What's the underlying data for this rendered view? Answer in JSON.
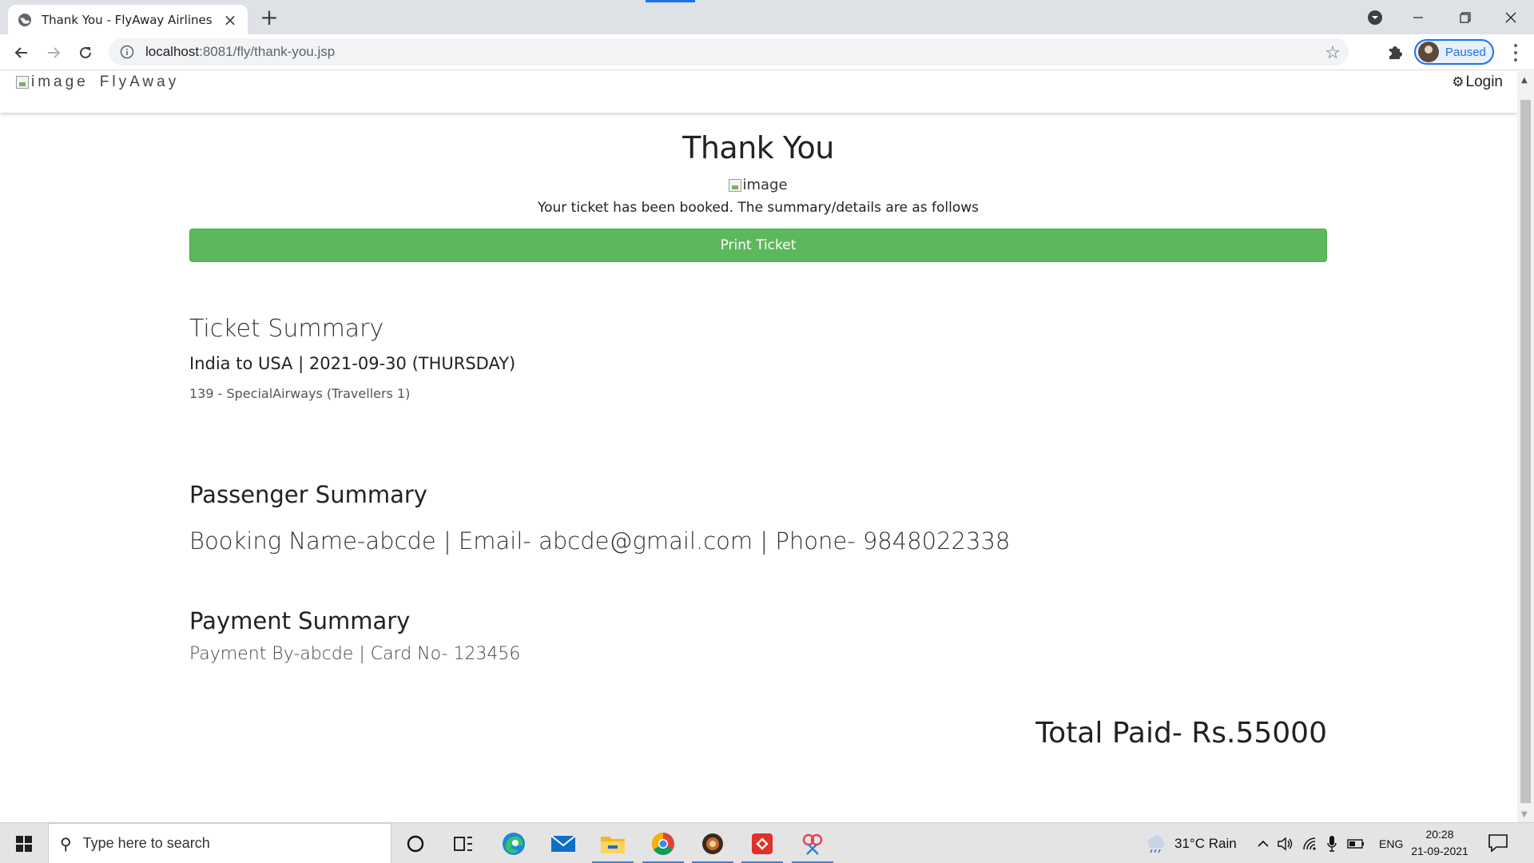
{
  "browser": {
    "tab_title": "Thank You - FlyAway Airlines",
    "url_host": "localhost",
    "url_path": ":8081/fly/thank-you.jsp",
    "profile_status": "Paused"
  },
  "site": {
    "brand_alt": "image",
    "brand_name": "FlyAway",
    "login_label": "Login"
  },
  "main": {
    "title": "Thank You",
    "hero_alt": "image",
    "booked_message": "Your ticket has been booked. The summary/details are as follows",
    "print_button": "Print Ticket"
  },
  "ticket": {
    "heading": "Ticket Summary",
    "route": "India to USA | 2021-09-30 (THURSDAY)",
    "flight": "139 - SpecialAirways (Travellers 1)"
  },
  "passenger": {
    "heading": "Passenger Summary",
    "details": "Booking Name-abcde | Email- abcde@gmail.com | Phone- 9848022338"
  },
  "payment": {
    "heading": "Payment Summary",
    "details": "Payment By-abcde | Card No- 123456",
    "total": "Total Paid- Rs.55000"
  },
  "taskbar": {
    "search_placeholder": "Type here to search",
    "weather": "31°C  Rain",
    "language": "ENG",
    "time": "20:28",
    "date": "21-09-2021"
  },
  "colors": {
    "print_button_bg": "#5cb85c",
    "chrome_accent": "#1a73e8"
  },
  "icons": [
    "globe-icon",
    "close-icon",
    "plus-icon",
    "back-icon",
    "forward-icon",
    "reload-icon",
    "info-icon",
    "star-icon",
    "puzzle-icon",
    "menu-icon",
    "gear-icon",
    "windows-icon",
    "search-icon",
    "cortana-icon",
    "task-view-icon",
    "edge-icon",
    "mail-icon",
    "file-explorer-icon",
    "chrome-icon",
    "app-icon",
    "git-icon",
    "snip-icon",
    "weather-icon",
    "chevron-up-icon",
    "speaker-icon",
    "wifi-icon",
    "microphone-icon",
    "battery-icon",
    "notification-icon"
  ]
}
